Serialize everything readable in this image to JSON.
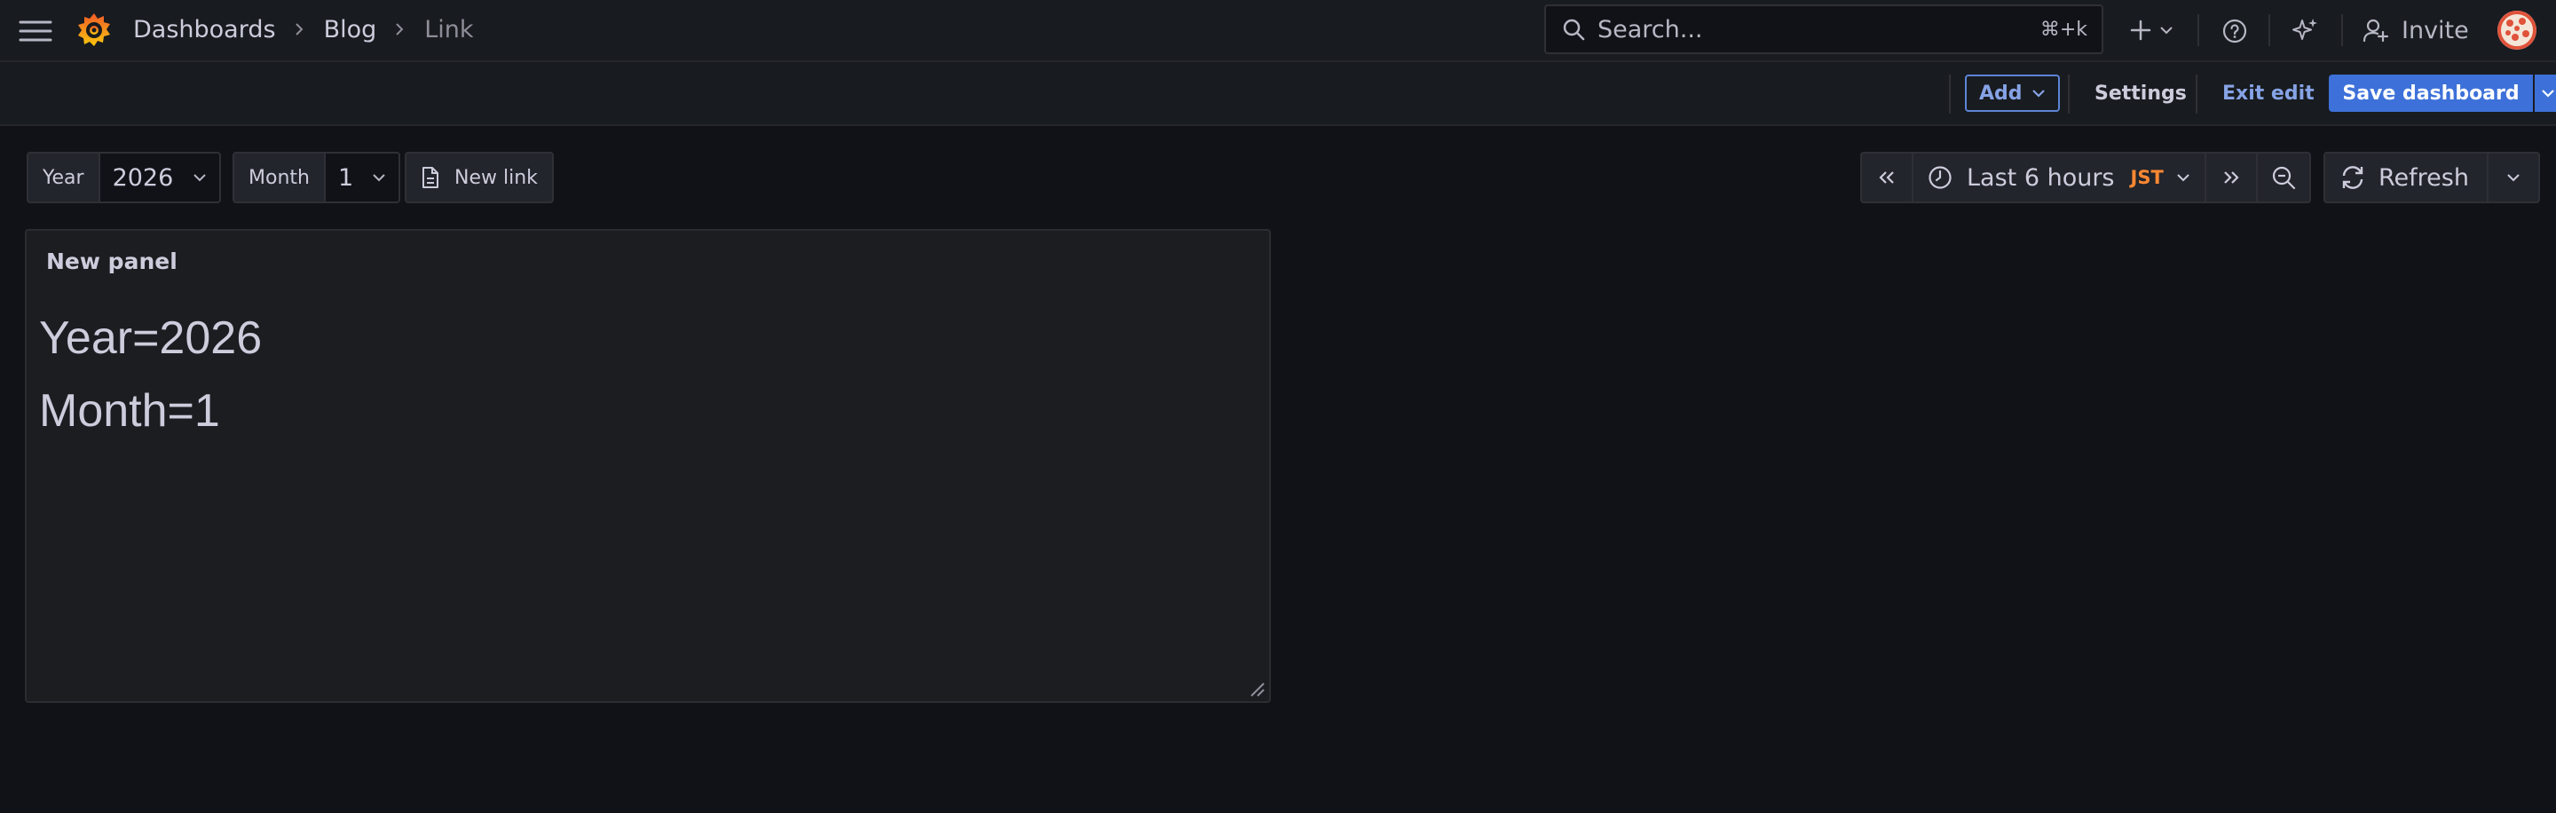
{
  "topnav": {
    "breadcrumbs": [
      "Dashboards",
      "Blog",
      "Link"
    ],
    "search_placeholder": "Search...",
    "search_shortcut": "⌘+k",
    "invite_label": "Invite",
    "icons": [
      "menu-icon",
      "grafana-logo",
      "search-icon",
      "plus-icon",
      "help-icon",
      "sparkle-icon",
      "invite-icon",
      "avatar"
    ]
  },
  "toolbar": {
    "add_label": "Add",
    "settings_label": "Settings",
    "exit_edit_label": "Exit edit",
    "save_label": "Save dashboard"
  },
  "variables": [
    {
      "label": "Year",
      "value": "2026"
    },
    {
      "label": "Month",
      "value": "1"
    }
  ],
  "links": {
    "new_link_label": "New link"
  },
  "time": {
    "range_label": "Last 6 hours",
    "timezone": "JST",
    "refresh_label": "Refresh"
  },
  "panel": {
    "title": "New panel",
    "lines": [
      "Year=2026",
      "Month=1"
    ]
  },
  "colors": {
    "background": "#111217",
    "nav_background": "#181b1f",
    "primary": "#3d71d9",
    "accent_link": "#86a3e6",
    "timezone": "#ff8833"
  }
}
